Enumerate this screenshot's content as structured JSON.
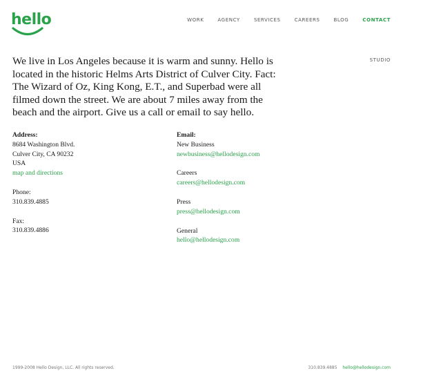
{
  "logo": {
    "text": "hello",
    "color": "#2aa24a"
  },
  "nav": {
    "items": [
      "WORK",
      "AGENCY",
      "SERVICES",
      "CAREERS",
      "BLOG",
      "CONTACT"
    ],
    "active": "CONTACT"
  },
  "studio_label": "STUDIO",
  "intro": "We live in Los Angeles because it is warm and sunny. Hello is located in the historic Helms Arts District of Culver City. Fact: The Wizard of Oz, King Kong, E.T., and Superbad were all filmed down the street. We are about 7 miles away from the beach and the airport. Give us a call or email to say hello.",
  "address": {
    "heading": "Address:",
    "line1": "8684 Washington Blvd.",
    "line2": "Culver City, CA 90232",
    "line3": "USA",
    "map_link": "map and directions"
  },
  "phone": {
    "heading": "Phone:",
    "value": "310.839.4885"
  },
  "fax": {
    "heading": "Fax:",
    "value": "310.839.4886"
  },
  "email": {
    "heading": "Email:",
    "groups": [
      {
        "label": "New Business",
        "address": "newbusiness@hellodesign.com"
      },
      {
        "label": "Careers",
        "address": "careers@hellodesign.com"
      },
      {
        "label": "Press",
        "address": "press@hellodesign.com"
      },
      {
        "label": "General",
        "address": "hello@hellodesign.com"
      }
    ]
  },
  "footer": {
    "copyright": "1999-2008 Hello Design, LLC. All rights reserved.",
    "phone": "310.839.4885",
    "email": "hello@hellodesign.com"
  }
}
